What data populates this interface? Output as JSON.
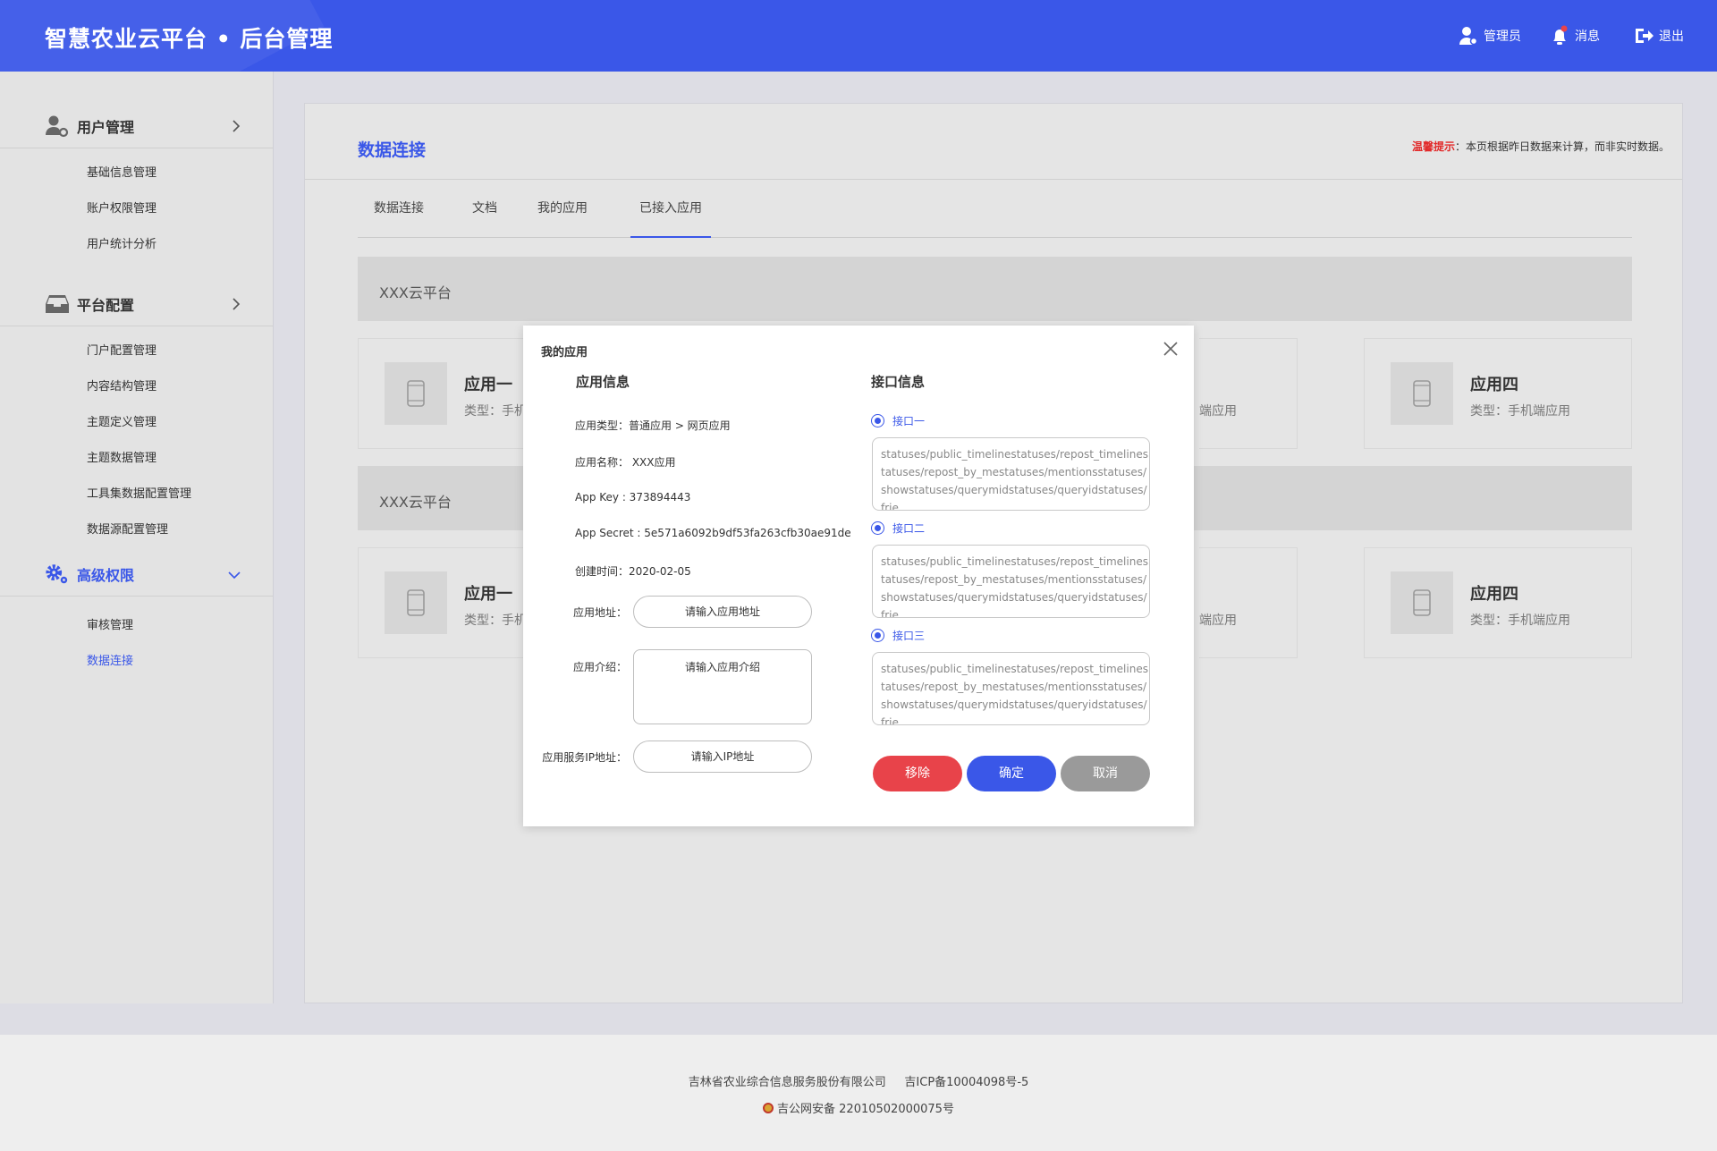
{
  "header": {
    "title": "智慧农业云平台 • 后台管理",
    "admin": "管理员",
    "messages": "消息",
    "logout": "退出",
    "accent": "#3a57e8"
  },
  "sidebar": {
    "groups": [
      {
        "label": "用户管理",
        "icon": "user-settings-icon",
        "items": [
          "基础信息管理",
          "账户权限管理",
          "用户统计分析"
        ]
      },
      {
        "label": "平台配置",
        "icon": "inbox-icon",
        "items": [
          "门户配置管理",
          "内容结构管理",
          "主题定义管理",
          "主题数据管理",
          "工具集数据配置管理",
          "数据源配置管理"
        ]
      },
      {
        "label": "高级权限",
        "icon": "gears-icon",
        "items": [
          "审核管理",
          "数据连接"
        ],
        "active_item": "数据连接"
      }
    ]
  },
  "main": {
    "title": "数据连接",
    "tip_lead": "温馨提示",
    "tip_text": "：本页根据昨日数据来计算，而非实时数据。",
    "tabs": [
      "数据连接",
      "文档",
      "我的应用",
      "已接入应用"
    ],
    "active_tab": "已接入应用",
    "platforms": [
      {
        "name": "XXX云平台",
        "apps": [
          {
            "name": "应用一",
            "type": "类型：手机"
          },
          {
            "tail": "端应用"
          },
          {
            "name": "应用四",
            "type": "类型：手机端应用"
          }
        ]
      },
      {
        "name": "XXX云平台",
        "apps": [
          {
            "name": "应用一",
            "type": "类型：手机"
          },
          {
            "tail": "端应用"
          },
          {
            "name": "应用四",
            "type": "类型：手机端应用"
          }
        ]
      }
    ]
  },
  "modal": {
    "title": "我的应用",
    "app_info": {
      "title": "应用信息",
      "type_line": "应用类型：普通应用   >   网页应用",
      "name_line": "应用名称：  XXX应用",
      "key_line": "App  Key : 373894443",
      "secret_line": "App Secret : 5e571a6092b9df53fa263cfb30ae91de",
      "created_line": "创建时间：2020-02-05",
      "url_label": "应用地址：",
      "url_placeholder": "请输入应用地址",
      "intro_label": "应用介绍：",
      "intro_placeholder": "请输入应用介绍",
      "ip_label": "应用服务IP地址：",
      "ip_placeholder": "请输入IP地址"
    },
    "api_info": {
      "title": "接口信息",
      "apis": [
        {
          "label": "接口一",
          "text": "statuses/public_timelinestatuses/repost_timelinestatuses/repost_by_mestatuses/mentionsstatuses/showstatuses/querymidstatuses/queryidstatuses/frie"
        },
        {
          "label": "接口二",
          "text": "statuses/public_timelinestatuses/repost_timelinestatuses/repost_by_mestatuses/mentionsstatuses/showstatuses/querymidstatuses/queryidstatuses/frie"
        },
        {
          "label": "接口三",
          "text": "statuses/public_timelinestatuses/repost_timelinestatuses/repost_by_mestatuses/mentionsstatuses/showstatuses/querymidstatuses/queryidstatuses/frie"
        }
      ]
    },
    "buttons": {
      "remove": "移除",
      "confirm": "确定",
      "cancel": "取消",
      "remove_color": "#e8434a",
      "confirm_color": "#3a57e8",
      "cancel_color": "#9a9a9a"
    }
  },
  "footer": {
    "company": "吉林省农业综合信息服务股份有限公司",
    "icp": "吉ICP备10004098号-5",
    "police": "吉公网安备 22010502000075号"
  }
}
